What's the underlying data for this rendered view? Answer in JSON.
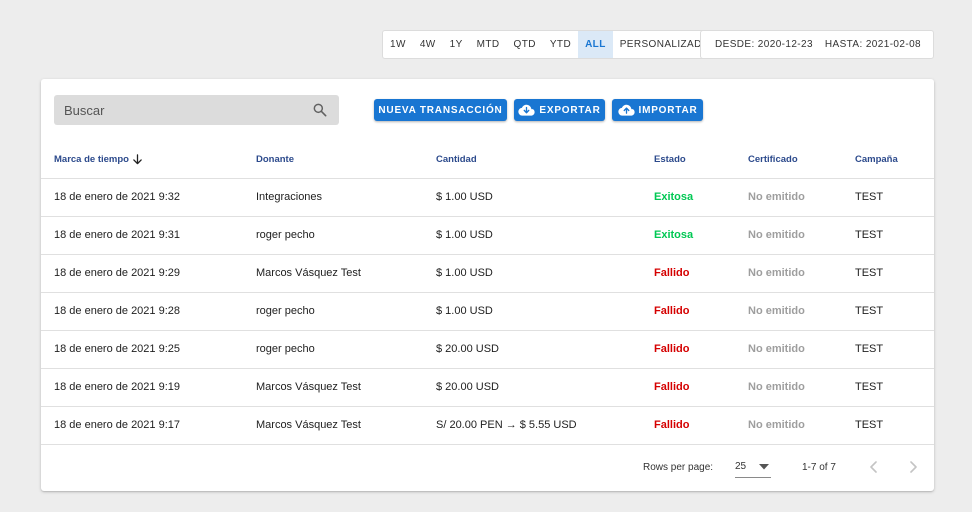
{
  "range_options": [
    {
      "label": "1W",
      "active": false
    },
    {
      "label": "4W",
      "active": false
    },
    {
      "label": "1Y",
      "active": false
    },
    {
      "label": "MTD",
      "active": false
    },
    {
      "label": "QTD",
      "active": false
    },
    {
      "label": "YTD",
      "active": false
    },
    {
      "label": "ALL",
      "active": true
    },
    {
      "label": "PERSONALIZADO",
      "active": false
    }
  ],
  "date_range": {
    "from": "DESDE: 2020-12-23",
    "to": "HASTA: 2021-02-08"
  },
  "search": {
    "placeholder": "Buscar",
    "value": "",
    "icon": "search-icon"
  },
  "actions": {
    "new": "NUEVA TRANSACCIÓN",
    "export": "EXPORTAR",
    "import": "IMPORTAR",
    "export_icon": "cloud-download-icon",
    "import_icon": "cloud-upload-icon"
  },
  "table": {
    "headers": [
      "Marca de tiempo",
      "Donante",
      "Cantidad",
      "Estado",
      "Certificado",
      "Campaña"
    ],
    "sort_icon": "arrow-down-icon",
    "rows": [
      {
        "time": "18 de enero de 2021 9:32",
        "donor": "Integraciones",
        "amount": "$ 1.00 USD",
        "status": "Exitosa",
        "status_type": "ok",
        "cert": "No emitido",
        "campaign": "TEST"
      },
      {
        "time": "18 de enero de 2021 9:31",
        "donor": "roger pecho",
        "amount": "$ 1.00 USD",
        "status": "Exitosa",
        "status_type": "ok",
        "cert": "No emitido",
        "campaign": "TEST"
      },
      {
        "time": "18 de enero de 2021 9:29",
        "donor": "Marcos Vásquez Test",
        "amount": "$ 1.00 USD",
        "status": "Fallido",
        "status_type": "fail",
        "cert": "No emitido",
        "campaign": "TEST"
      },
      {
        "time": "18 de enero de 2021 9:28",
        "donor": "roger pecho",
        "amount": "$ 1.00 USD",
        "status": "Fallido",
        "status_type": "fail",
        "cert": "No emitido",
        "campaign": "TEST"
      },
      {
        "time": "18 de enero de 2021 9:25",
        "donor": "roger pecho",
        "amount": "$ 20.00 USD",
        "status": "Fallido",
        "status_type": "fail",
        "cert": "No emitido",
        "campaign": "TEST"
      },
      {
        "time": "18 de enero de 2021 9:19",
        "donor": "Marcos Vásquez Test",
        "amount": "$ 20.00 USD",
        "status": "Fallido",
        "status_type": "fail",
        "cert": "No emitido",
        "campaign": "TEST"
      },
      {
        "time": "18 de enero de 2021 9:17",
        "donor": "Marcos Vásquez Test",
        "amount": "S/ 20.00 PEN → $ 5.55 USD",
        "status": "Fallido",
        "status_type": "fail",
        "cert": "No emitido",
        "campaign": "TEST"
      }
    ]
  },
  "pagination": {
    "rows_per_page_label": "Rows per page:",
    "rows_per_page": "25",
    "range": "1-7 of 7",
    "prev_icon": "chevron-left-icon",
    "next_icon": "chevron-right-icon"
  },
  "colors": {
    "primary": "#1976d2",
    "success": "#00c853",
    "error": "#d50000",
    "header_text": "#2c4a8c",
    "muted": "#9e9e9e"
  }
}
